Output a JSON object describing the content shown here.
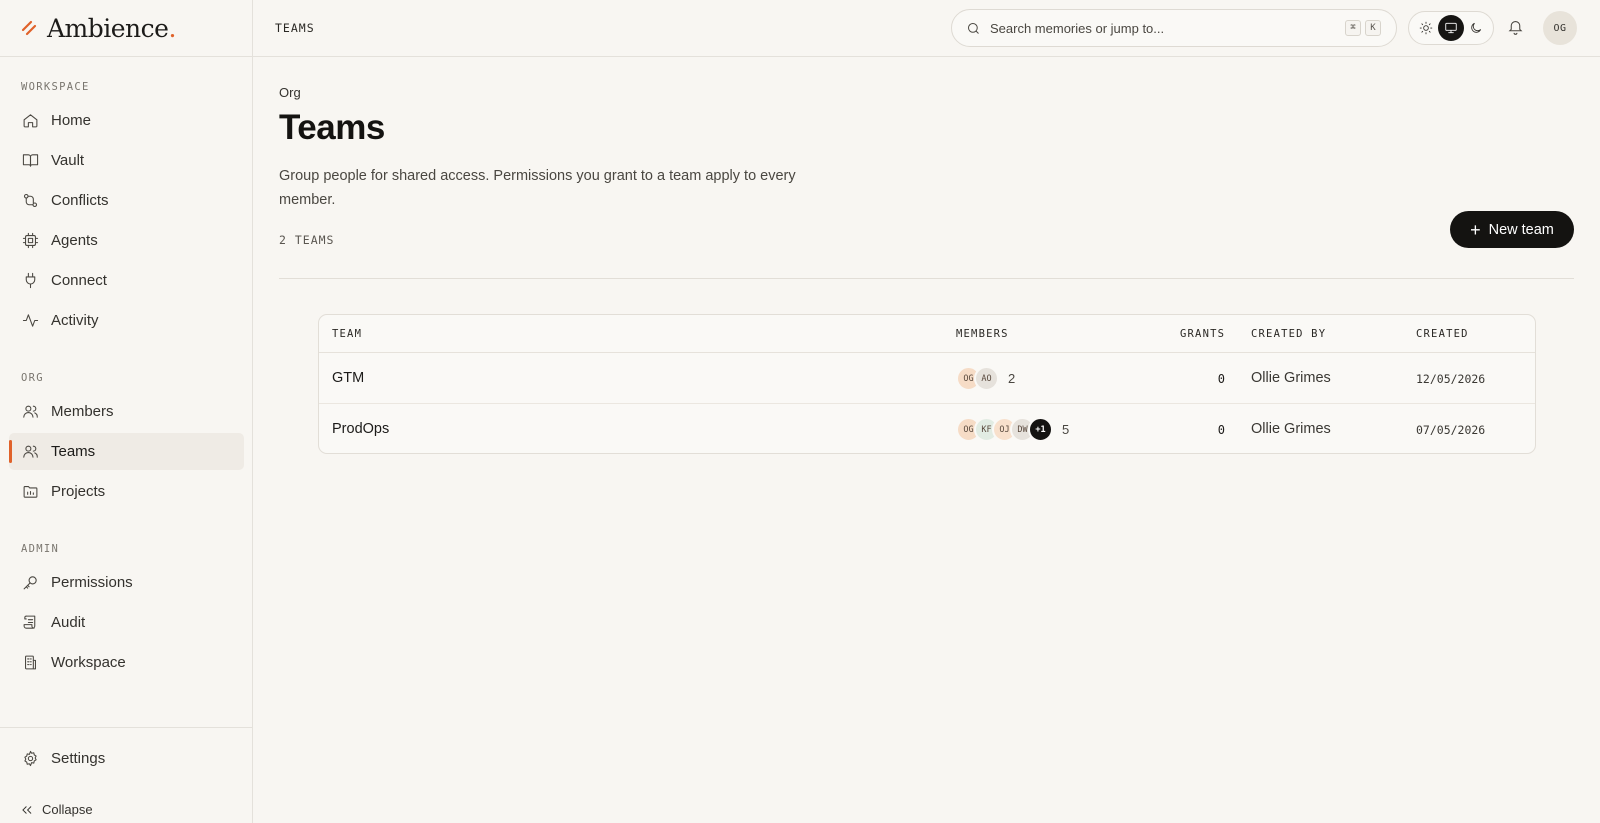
{
  "app": {
    "name": "Ambience",
    "name_dot": "."
  },
  "sidebar": {
    "sections": [
      {
        "label": "WORKSPACE"
      },
      {
        "label": "ORG"
      },
      {
        "label": "ADMIN"
      }
    ],
    "items": [
      {
        "label": "Home",
        "icon": "home-icon"
      },
      {
        "label": "Vault",
        "icon": "book-icon"
      },
      {
        "label": "Conflicts",
        "icon": "merge-icon"
      },
      {
        "label": "Agents",
        "icon": "cpu-icon"
      },
      {
        "label": "Connect",
        "icon": "plug-icon"
      },
      {
        "label": "Activity",
        "icon": "activity-icon"
      },
      {
        "label": "Members",
        "icon": "users-icon"
      },
      {
        "label": "Teams",
        "icon": "users-icon",
        "active": true
      },
      {
        "label": "Projects",
        "icon": "folder-icon"
      },
      {
        "label": "Permissions",
        "icon": "key-icon"
      },
      {
        "label": "Audit",
        "icon": "scroll-icon"
      },
      {
        "label": "Workspace",
        "icon": "building-icon"
      }
    ],
    "settings_label": "Settings",
    "collapse_label": "Collapse"
  },
  "topbar": {
    "breadcrumb": "TEAMS",
    "search_placeholder": "Search memories or jump to...",
    "shortcut_key1": "⌘",
    "shortcut_key2": "K",
    "theme_options": [
      "light",
      "system",
      "dark"
    ],
    "theme_selected": "system",
    "user_initials": "OG"
  },
  "page": {
    "eyebrow": "Org",
    "title": "Teams",
    "description": "Group people for shared access. Permissions you grant to a team apply to every member.",
    "count_label": "2 TEAMS",
    "new_button": "New team"
  },
  "table": {
    "columns": [
      "TEAM",
      "MEMBERS",
      "GRANTS",
      "CREATED BY",
      "CREATED"
    ],
    "rows": [
      {
        "team": "GTM",
        "avatars": [
          {
            "initials": "OG",
            "color": "#f6dcc6"
          },
          {
            "initials": "AO",
            "color": "#e6e2dc"
          }
        ],
        "more": "",
        "member_count": "2",
        "grants": "0",
        "created_by": "Ollie Grimes",
        "created": "12/05/2026"
      },
      {
        "team": "ProdOps",
        "avatars": [
          {
            "initials": "OG",
            "color": "#f6dcc6"
          },
          {
            "initials": "KF",
            "color": "#e2ece3"
          },
          {
            "initials": "OJ",
            "color": "#f8e0cc"
          },
          {
            "initials": "DW",
            "color": "#e6e2dc"
          }
        ],
        "more": "+1",
        "member_count": "5",
        "grants": "0",
        "created_by": "Ollie Grimes",
        "created": "07/05/2026"
      }
    ]
  },
  "colors": {
    "accent": "#e0622a",
    "background": "#f8f6f2",
    "primary_button": "#141311"
  }
}
